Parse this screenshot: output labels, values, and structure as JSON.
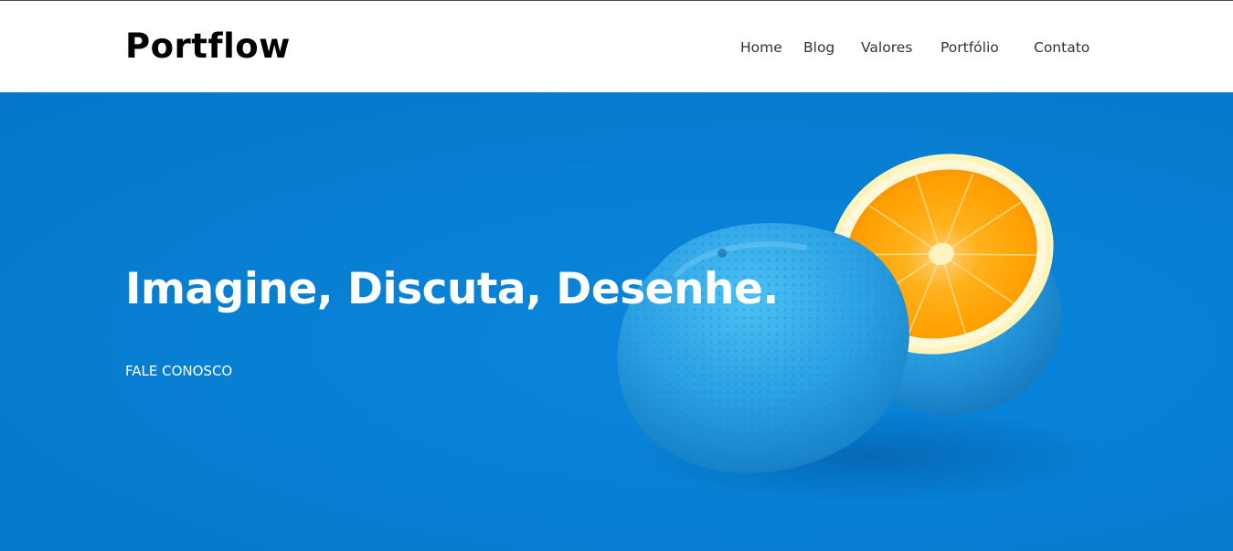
{
  "brand": {
    "logo_text": "Portflow"
  },
  "nav": {
    "items": [
      {
        "label": "Home"
      },
      {
        "label": "Blog"
      },
      {
        "label": "Valores"
      },
      {
        "label": "Portfólio"
      },
      {
        "label": "Contato"
      }
    ]
  },
  "hero": {
    "headline": "Imagine, Discuta, Desenhe.",
    "cta_label": "FALE CONOSCO",
    "background_color": "#0780d4",
    "image_subject": "orange-painted-blue-cut-in-half"
  },
  "colors": {
    "header_bg": "#ffffff",
    "logo": "#000000",
    "nav_text": "#333333",
    "hero_text": "#ffffff",
    "orange_flesh": "#ffa50a",
    "peel_blue": "#29a3e3"
  }
}
